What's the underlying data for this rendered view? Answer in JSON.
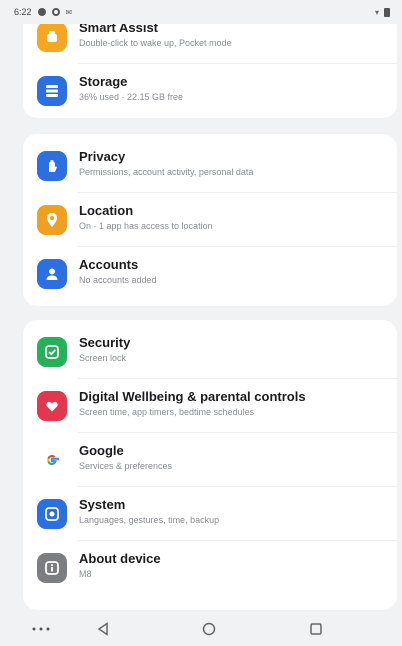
{
  "status_bar": {
    "time": "6:22",
    "left_icons": [
      "notification-icon",
      "settings-status-icon",
      "message-status-icon"
    ],
    "right_icons": [
      "wifi-icon",
      "battery-icon"
    ]
  },
  "settings": {
    "groups": [
      {
        "items": [
          {
            "title": "Smart Assist",
            "subtitle": "Double-click to wake up, Pocket mode",
            "icon": "smart-assist-icon",
            "color": "#f5a623"
          },
          {
            "title": "Storage",
            "subtitle": "36% used · 22.15 GB free",
            "icon": "storage-icon",
            "color": "#2b6fe0"
          }
        ]
      },
      {
        "items": [
          {
            "title": "Privacy",
            "subtitle": "Permissions, account activity, personal data",
            "icon": "privacy-icon",
            "color": "#2b6fe0"
          },
          {
            "title": "Location",
            "subtitle": "On · 1 app has access to location",
            "icon": "location-icon",
            "color": "#f0a020"
          },
          {
            "title": "Accounts",
            "subtitle": "No accounts added",
            "icon": "accounts-icon",
            "color": "#2b6fe0"
          }
        ]
      },
      {
        "items": [
          {
            "title": "Security",
            "subtitle": "Screen lock",
            "icon": "security-icon",
            "color": "#27b05a"
          },
          {
            "title": "Digital Wellbeing & parental controls",
            "subtitle": "Screen time, app timers, bedtime schedules",
            "icon": "digital-wellbeing-icon",
            "color": "#e3364f"
          },
          {
            "title": "Google",
            "subtitle": "Services & preferences",
            "icon": "google-icon",
            "color": "#ffffff"
          },
          {
            "title": "System",
            "subtitle": "Languages, gestures, time, backup",
            "icon": "system-icon",
            "color": "#2b6fe0"
          },
          {
            "title": "About device",
            "subtitle": "M8",
            "icon": "about-device-icon",
            "color": "#7b7d80"
          }
        ]
      }
    ]
  },
  "nav_bar": {
    "buttons": [
      "menu-dots-icon",
      "back-icon",
      "home-icon",
      "recents-icon"
    ]
  }
}
